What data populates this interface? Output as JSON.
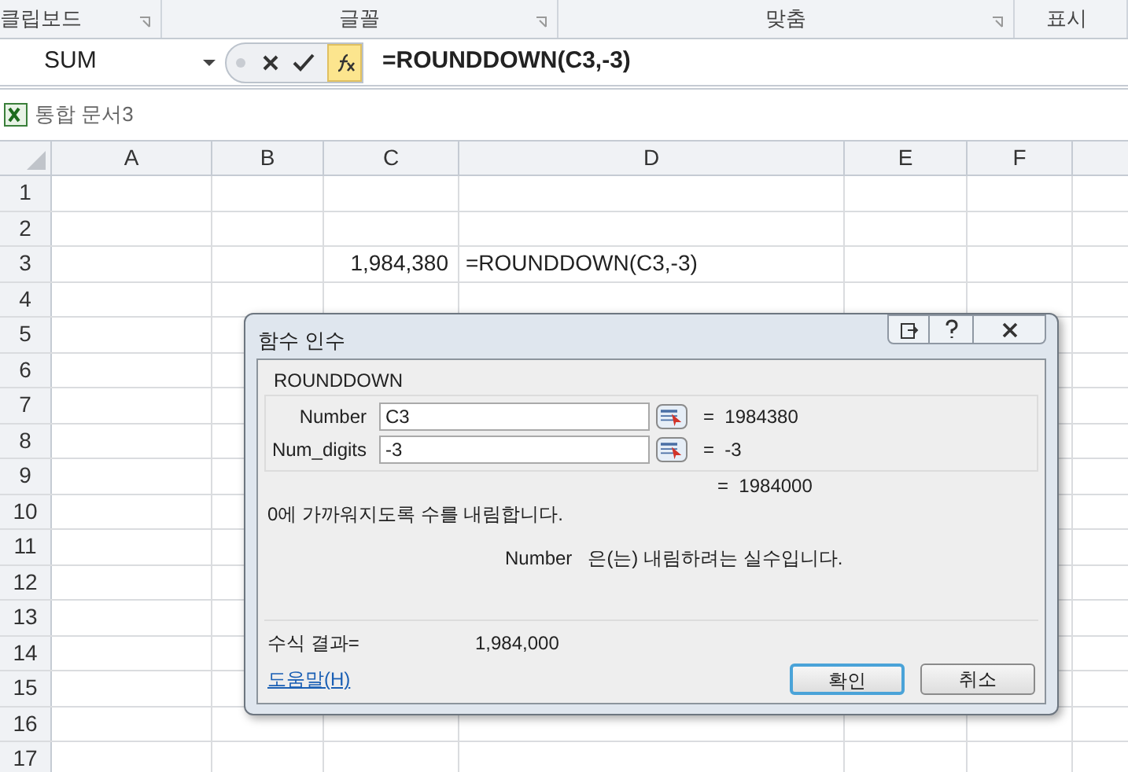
{
  "ribbon_groups": [
    {
      "label": "클립보드",
      "launcher": true
    },
    {
      "label": "글꼴",
      "launcher": true
    },
    {
      "label": "맞춤",
      "launcher": true
    },
    {
      "label": "표시",
      "launcher": false
    }
  ],
  "formula_bar": {
    "name_box": "SUM",
    "formula": "=ROUNDDOWN(C3,-3)"
  },
  "workbook": {
    "title": "통합 문서3"
  },
  "sheet": {
    "columns": [
      "A",
      "B",
      "C",
      "D",
      "E",
      "F"
    ],
    "rows": [
      {
        "label": "1"
      },
      {
        "label": "2"
      },
      {
        "label": "3",
        "cells": {
          "column_3": "1,984,380",
          "column_4": "=ROUNDDOWN(C3,-3)"
        }
      },
      {
        "label": "4"
      },
      {
        "label": "5"
      },
      {
        "label": "6"
      },
      {
        "label": "7"
      },
      {
        "label": "8"
      },
      {
        "label": "9"
      },
      {
        "label": "10"
      },
      {
        "label": "11"
      },
      {
        "label": "12"
      },
      {
        "label": "13"
      },
      {
        "label": "14"
      },
      {
        "label": "15"
      },
      {
        "label": "16"
      },
      {
        "label": "17"
      }
    ]
  },
  "dialog": {
    "title": "함수 인수",
    "function_name": "ROUNDDOWN",
    "arguments": [
      {
        "label": "Number",
        "value": "C3",
        "result": "=  1984380"
      },
      {
        "label": "Num_digits",
        "value": "-3",
        "result": "=  -3"
      }
    ],
    "result": "=  1984000",
    "description": "0에 가까워지도록 수를 내림합니다.",
    "argument_help": {
      "name": "Number",
      "text": "은(는) 내림하려는 실수입니다."
    },
    "formula_result_label": "수식 결과=",
    "formula_result": "1,984,000",
    "help_link": "도움말(H)",
    "buttons": [
      {
        "label": "확인",
        "default": true
      },
      {
        "label": "취소",
        "default": false
      }
    ]
  }
}
